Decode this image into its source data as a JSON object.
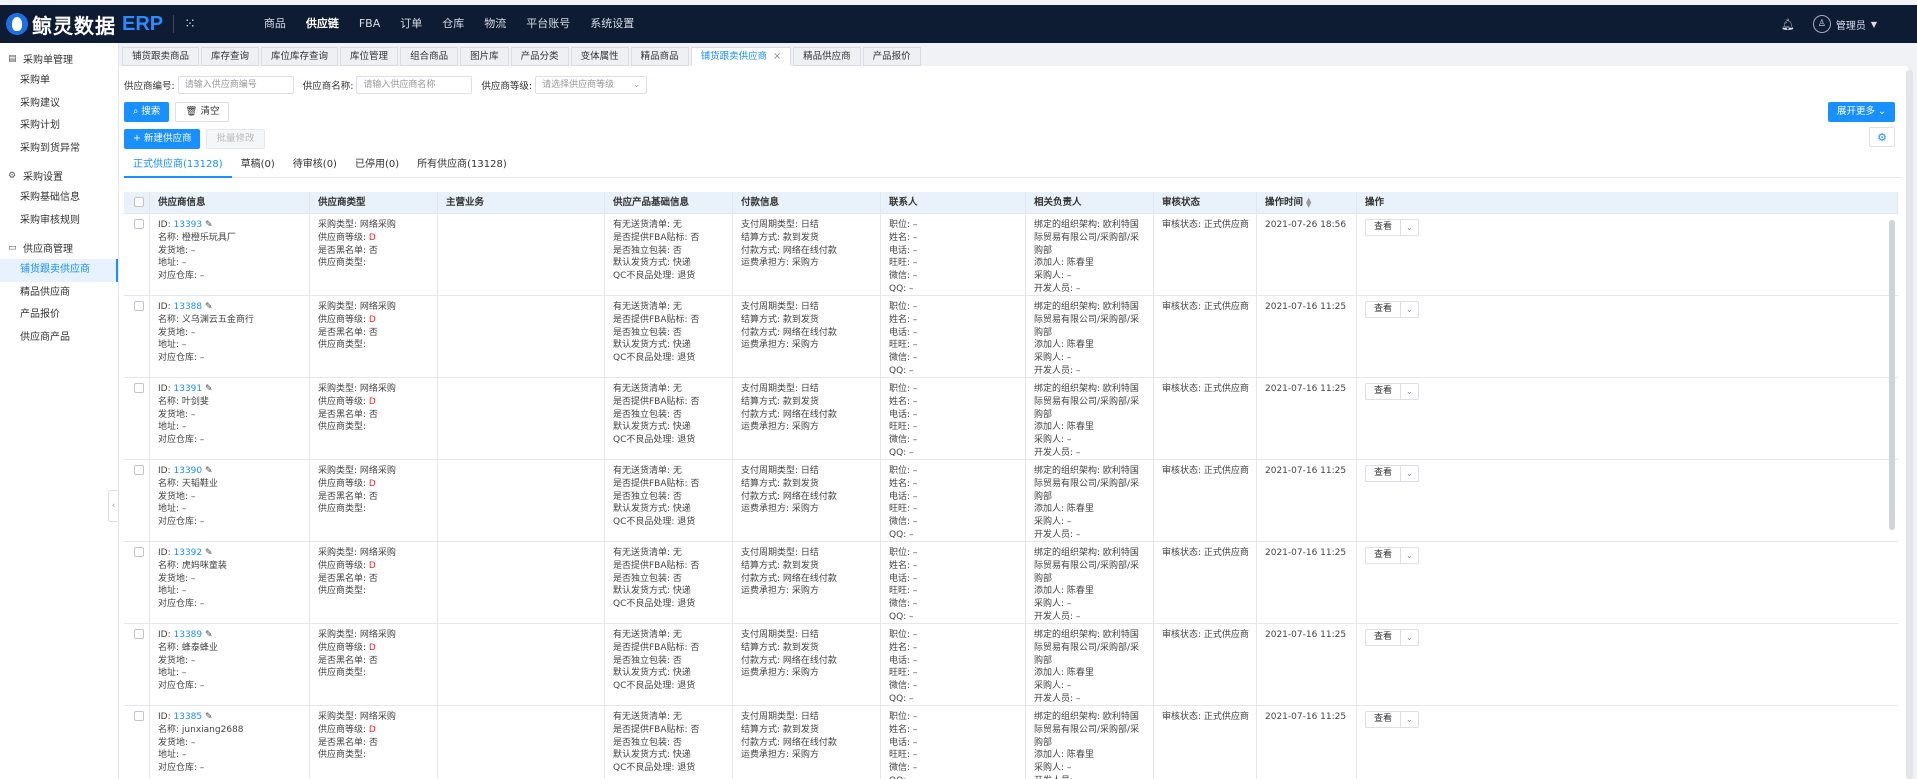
{
  "app": {
    "logo_text": "鲸灵数据",
    "logo_erp": "ERP"
  },
  "topnav": [
    "商品",
    "供应链",
    "FBA",
    "订单",
    "仓库",
    "物流",
    "平台账号",
    "系统设置"
  ],
  "topnav_active": 1,
  "user": {
    "name": "管理员"
  },
  "sidebar": {
    "groups": [
      {
        "title": "采购单管理",
        "icon": "document-icon",
        "items": [
          "采购单",
          "采购建议",
          "采购计划",
          "采购到货异常"
        ]
      },
      {
        "title": "采购设置",
        "icon": "gear-icon",
        "items": [
          "采购基础信息",
          "采购审核规则"
        ]
      },
      {
        "title": "供应商管理",
        "icon": "folder-icon",
        "items": [
          "铺货跟卖供应商",
          "精品供应商",
          "产品报价",
          "供应商产品"
        ]
      }
    ],
    "active_item": "铺货跟卖供应商"
  },
  "tabs": [
    "铺货跟卖商品",
    "库存查询",
    "库位库存查询",
    "库位管理",
    "组合商品",
    "图片库",
    "产品分类",
    "变体属性",
    "精品商品",
    "铺货跟卖供应商",
    "精品供应商",
    "产品报价"
  ],
  "active_tab": 9,
  "filters": {
    "supplier_no_label": "供应商编号:",
    "supplier_no_placeholder": "请输入供应商编号",
    "supplier_name_label": "供应商名称:",
    "supplier_name_placeholder": "请输入供应商名称",
    "supplier_level_label": "供应商等级:",
    "supplier_level_placeholder": "请选择供应商等级"
  },
  "buttons": {
    "search": "搜索",
    "clear": "清空",
    "new_supplier": "+ 新建供应商",
    "batch_edit": "批量修改",
    "expand_more": "展开更多"
  },
  "subtabs": [
    "正式供应商(13128)",
    "草稿(0)",
    "待审核(0)",
    "已停用(0)",
    "所有供应商(13128)"
  ],
  "active_subtab": 0,
  "table": {
    "headers": [
      "供应商信息",
      "供应商类型",
      "主营业务",
      "供应产品基础信息",
      "付款信息",
      "联系人",
      "相关负责人",
      "审核状态",
      "操作时间",
      "操作"
    ],
    "view_label": "查看",
    "rows": [
      {
        "id": "13393",
        "name": "橙橙乐玩具厂",
        "time": "2021-07-26 18:56"
      },
      {
        "id": "13388",
        "name": "义乌渊云五金商行",
        "time": "2021-07-16 11:25"
      },
      {
        "id": "13391",
        "name": "叶剑斐",
        "time": "2021-07-16 11:25"
      },
      {
        "id": "13390",
        "name": "天韬鞋业",
        "time": "2021-07-16 11:25"
      },
      {
        "id": "13392",
        "name": "虎妈咪童装",
        "time": "2021-07-16 11:25"
      },
      {
        "id": "13389",
        "name": "蜂泰蜂业",
        "time": "2021-07-16 11:25"
      },
      {
        "id": "13385",
        "name": "junxiang2688",
        "time": "2021-07-16 11:25"
      }
    ],
    "common": {
      "id_label": "ID:",
      "name_label": "名称:",
      "ship_from": "发货地: –",
      "address": "地址: –",
      "warehouse": "对应仓库: –",
      "purchase_type": "采购类型: 网络采购",
      "level_label": "供应商等级:",
      "level_value": "D",
      "blacklist": "是否黑名单: 否",
      "supplier_type": "供应商类型:",
      "free_list": "有无送货清单: 无",
      "fba_label": "是否提供FBA贴标: 否",
      "independent_pack": "是否独立包装: 否",
      "default_ship": "默认发货方式: 快递",
      "qc": "QC不良品处理: 退货",
      "pay_cycle": "支付周期类型: 日结",
      "settle": "结算方式: 款到发货",
      "pay_method": "付款方式: 网络在线付款",
      "freight": "运费承担方: 采购方",
      "contact": [
        "职位: –",
        "姓名: –",
        "电话: –",
        "旺旺: –",
        "微信: –",
        "QQ: –"
      ],
      "owner_org": "绑定的组织架构: 欧利特国际贸易有限公司/采购部/采购部",
      "owner_added": "添加人: 陈春里",
      "owner_buyer": "采购人: –",
      "owner_dev": "开发人员: –",
      "audit": "审核状态: 正式供应商"
    }
  }
}
